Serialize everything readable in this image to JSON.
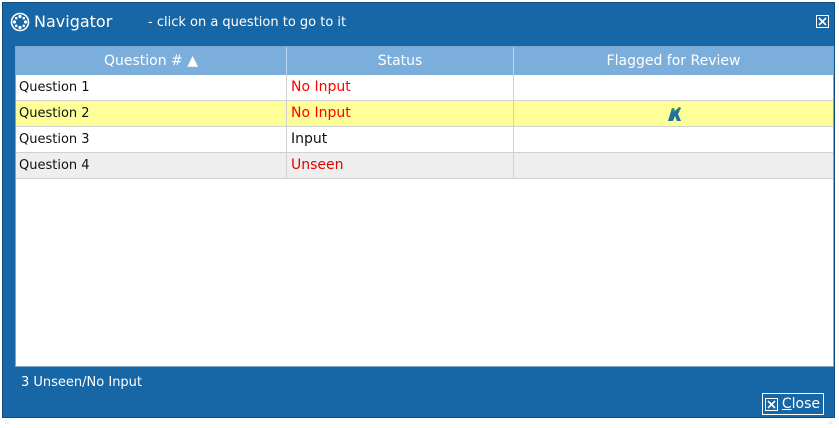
{
  "window": {
    "title": "Navigator",
    "subtitle": "- click on a question to go to it",
    "title_icon": "navigator-icon",
    "close_icon": "close-box-icon"
  },
  "grid": {
    "columns": [
      {
        "label": "Question # ▲",
        "sort": "ascending"
      },
      {
        "label": "Status"
      },
      {
        "label": "Flagged for Review"
      }
    ],
    "rows": [
      {
        "question": "Question 1",
        "status": "No Input",
        "status_color": "#ff0000",
        "flagged": false,
        "highlight": "none"
      },
      {
        "question": "Question 2",
        "status": "No Input",
        "status_color": "#ff0000",
        "flagged": true,
        "highlight": "selected"
      },
      {
        "question": "Question 3",
        "status": "Input",
        "status_color": "#111111",
        "flagged": false,
        "highlight": "none"
      },
      {
        "question": "Question 4",
        "status": "Unseen",
        "status_color": "#e00000",
        "flagged": false,
        "highlight": "alt"
      }
    ],
    "flag_icon": "flag-for-review-icon"
  },
  "footer": {
    "summary": "3 Unseen/No Input",
    "close_label_underlined": "C",
    "close_label_rest": "lose"
  },
  "colors": {
    "window_bg": "#1766a6",
    "header_bg": "#7baedb",
    "selected_row": "#ffff99",
    "alt_row": "#eeeeee",
    "status_red": "#ff0000"
  }
}
